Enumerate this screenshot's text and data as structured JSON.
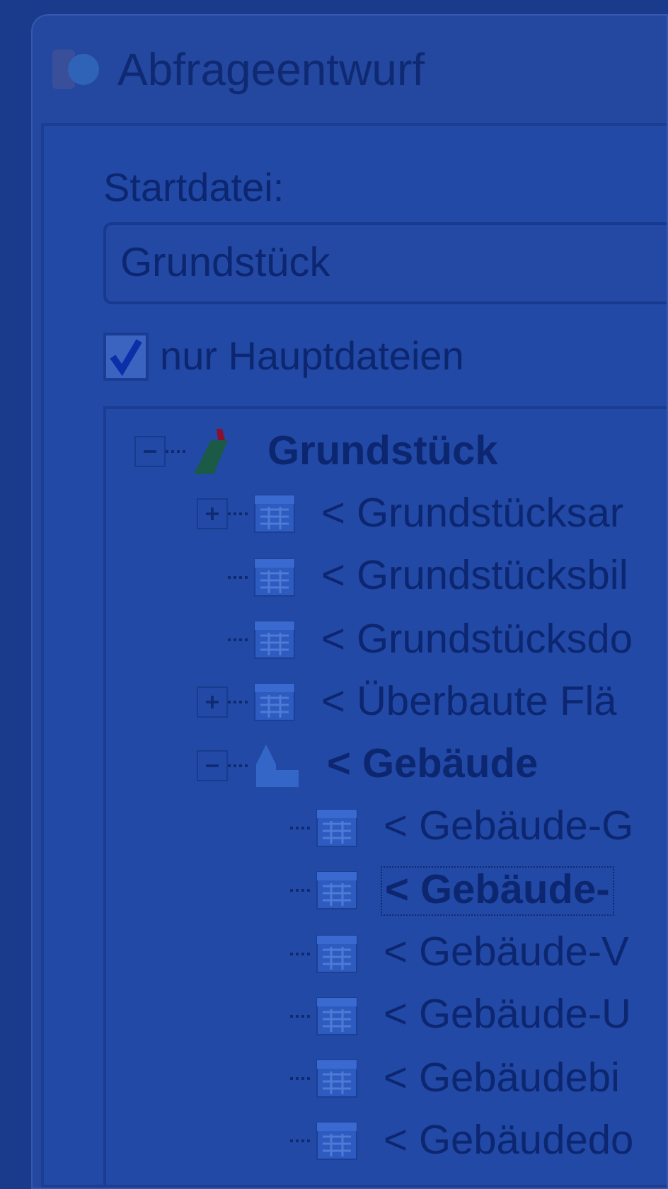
{
  "window": {
    "title": "Abfrageentwurf"
  },
  "start_file": {
    "label": "Startdatei:",
    "value": "Grundstück"
  },
  "main_files_only": {
    "label": "nur Hauptdateien",
    "checked": true
  },
  "tree": [
    {
      "label": "Grundstück",
      "kind": "pen",
      "bold": true,
      "selected": false,
      "expanded": true,
      "children": [
        {
          "label": "< Grundstücksar",
          "kind": "table",
          "bold": false,
          "selected": false,
          "expanded": false
        },
        {
          "label": "< Grundstücksbil",
          "kind": "table",
          "bold": false,
          "selected": false
        },
        {
          "label": "< Grundstücksdo",
          "kind": "table",
          "bold": false,
          "selected": false
        },
        {
          "label": "< Überbaute Flä",
          "kind": "table",
          "bold": false,
          "selected": false,
          "expanded": false
        },
        {
          "label": "< Gebäude",
          "kind": "building",
          "bold": true,
          "selected": false,
          "expanded": true,
          "children": [
            {
              "label": "< Gebäude-G",
              "kind": "table",
              "bold": false,
              "selected": false
            },
            {
              "label": "< Gebäude-",
              "kind": "table",
              "bold": true,
              "selected": true
            },
            {
              "label": "< Gebäude-V",
              "kind": "table",
              "bold": false,
              "selected": false
            },
            {
              "label": "< Gebäude-U",
              "kind": "table",
              "bold": false,
              "selected": false
            },
            {
              "label": "< Gebäudebi",
              "kind": "table",
              "bold": false,
              "selected": false
            },
            {
              "label": "< Gebäudedo",
              "kind": "table",
              "bold": false,
              "selected": false
            }
          ]
        }
      ]
    }
  ]
}
